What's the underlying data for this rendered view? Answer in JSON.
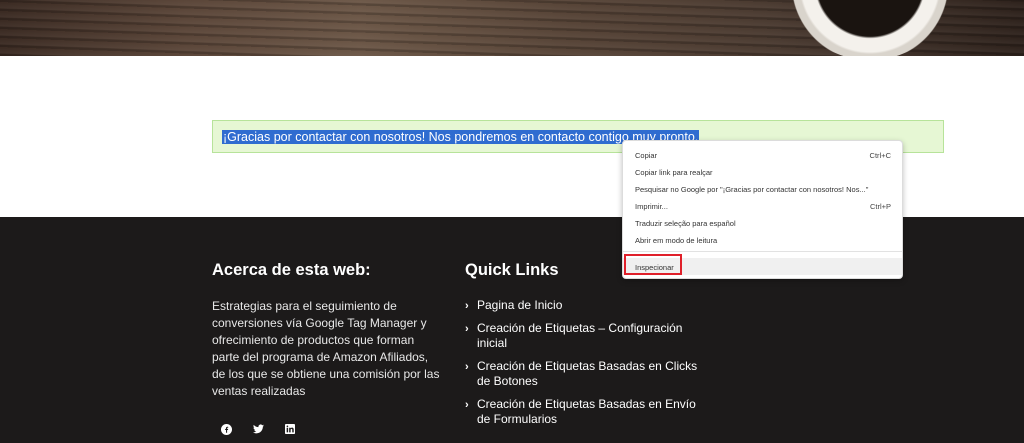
{
  "notice": {
    "message": "¡Gracias por contactar con nosotros! Nos pondremos en contacto contigo muy pronto."
  },
  "footer": {
    "about": {
      "title": "Acerca de esta web:",
      "text": "Estrategias para el seguimiento de conversiones vía Google Tag Manager y ofrecimiento de productos que forman parte del programa de Amazon Afiliados, de los que se obtiene una comisión por las ventas realizadas"
    },
    "social": [
      "facebook-icon",
      "twitter-icon",
      "linkedin-icon"
    ],
    "quick_links": {
      "title": "Quick Links",
      "items": [
        "Pagina de Inicio",
        "Creación de Etiquetas – Configuración inicial",
        "Creación de Etiquetas Basadas en Clicks de Botones",
        "Creación de Etiquetas Basadas en Envío de Formularios"
      ]
    }
  },
  "context_menu": {
    "items": [
      {
        "label": "Copiar",
        "shortcut": "Ctrl+C"
      },
      {
        "label": "Copiar link para realçar",
        "shortcut": ""
      },
      {
        "label": "Pesquisar no Google por \"¡Gracias por contactar con nosotros! Nos...\"",
        "shortcut": ""
      },
      {
        "label": "Imprimir...",
        "shortcut": "Ctrl+P"
      },
      {
        "label": "Traduzir seleção para español",
        "shortcut": ""
      },
      {
        "label": "Abrir em modo de leitura",
        "shortcut": ""
      },
      {
        "label": "Inspecionar",
        "shortcut": ""
      }
    ]
  },
  "colors": {
    "footer_bg": "#1c1a1a",
    "notice_bg": "#e6f7d4",
    "selection": "#2f6cd0",
    "highlight_box": "#e0202a"
  }
}
